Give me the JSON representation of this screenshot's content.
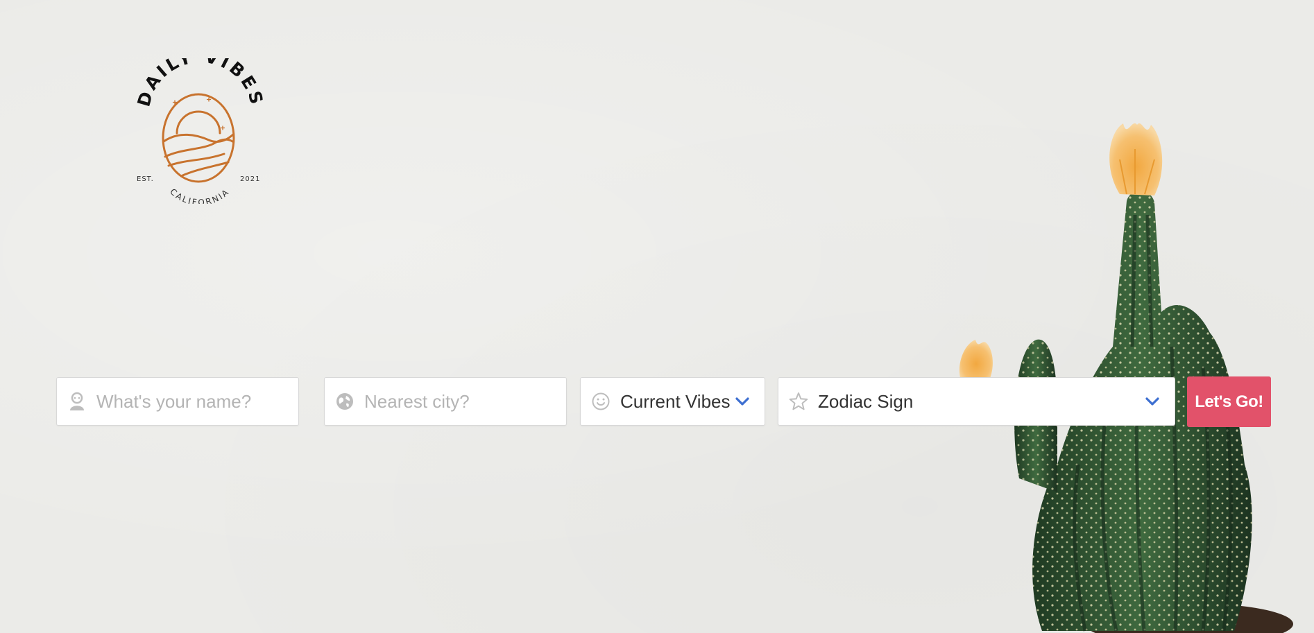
{
  "brand": {
    "name": "DAILY VIBES",
    "established": "EST.",
    "year": "2021",
    "location": "CALIFORNIA",
    "accent": "#c8732e"
  },
  "form": {
    "name": {
      "placeholder": "What's your name?",
      "icon": "person-icon"
    },
    "city": {
      "placeholder": "Nearest city?",
      "icon": "globe-icon"
    },
    "vibes": {
      "value": "Current Vibes",
      "icon": "smiley-icon"
    },
    "zodiac": {
      "value": "Zodiac Sign",
      "icon": "star-icon"
    },
    "submit_label": "Let's Go!"
  },
  "colors": {
    "background": "#ebebe8",
    "button": "#e2526a",
    "chevron": "#3d6fd1",
    "icon_gray": "#bdbdbd"
  }
}
